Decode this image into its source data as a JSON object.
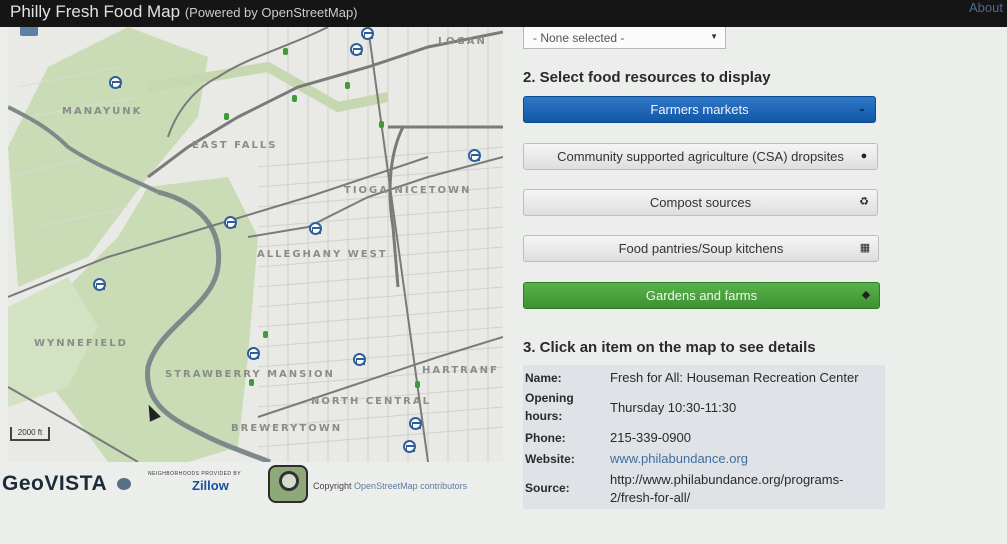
{
  "header": {
    "title": "Philly Fresh Food Map",
    "subtitle": "(Powered by OpenStreetMap)",
    "about_link": "About"
  },
  "map": {
    "labels": {
      "logan": "LOGAN",
      "manayunk": "MANAYUNK",
      "east_falls": "EAST FALLS",
      "tioga_nicetown": "TIOGA NICETOWN",
      "allegheny_west": "ALLEGHANY WEST",
      "wynnefield": "WYNNEFIELD",
      "strawberry_mansion": "STRAWBERRY MANSION",
      "north_central": "NORTH CENTRAL",
      "hartranft": "HARTRANF",
      "brewerytown": "BREWERYTOWN"
    },
    "scale_label": "2000 ft",
    "colors": {
      "park": "#c9dcb5",
      "road": "#7a7a7a",
      "river": "#7e8a8a",
      "market_pin": "#2f5f9a",
      "garden_dot": "#3f9a3a"
    }
  },
  "footer": {
    "geovista": "GeoVISTA",
    "zillow_caption": "NEIGHBORHOODS PROVIDED BY",
    "zillow": "Zillow",
    "copyright_prefix": "Copyright",
    "copyright_link": "OpenStreetMap contributors"
  },
  "panel": {
    "select_value": "- None selected -",
    "step2_heading": "2. Select food resources to display",
    "buttons": [
      {
        "label": "Farmers markets",
        "icon": "basket-icon",
        "state": "active"
      },
      {
        "label": "Community supported agriculture (CSA) dropsites",
        "icon": "apple-icon",
        "state": "default"
      },
      {
        "label": "Compost sources",
        "icon": "recycle-icon",
        "state": "default"
      },
      {
        "label": "Food pantries/Soup kitchens",
        "icon": "grid-icon",
        "state": "default"
      },
      {
        "label": "Gardens and farms",
        "icon": "leaf-icon",
        "state": "active-green"
      }
    ],
    "step3_heading": "3. Click an item on the map to see details",
    "details": {
      "name_label": "Name:",
      "name_value": "Fresh for All: Houseman Recreation Center",
      "hours_label_1": "Opening",
      "hours_label_2": "hours:",
      "hours_value": "Thursday 10:30-11:30",
      "phone_label": "Phone:",
      "phone_value": "215-339-0900",
      "website_label": "Website:",
      "website_value": "www.philabundance.org",
      "source_label": "Source:",
      "source_value_1": "http://www.philabundance.org/programs-",
      "source_value_2": "2/fresh-for-all/"
    }
  }
}
